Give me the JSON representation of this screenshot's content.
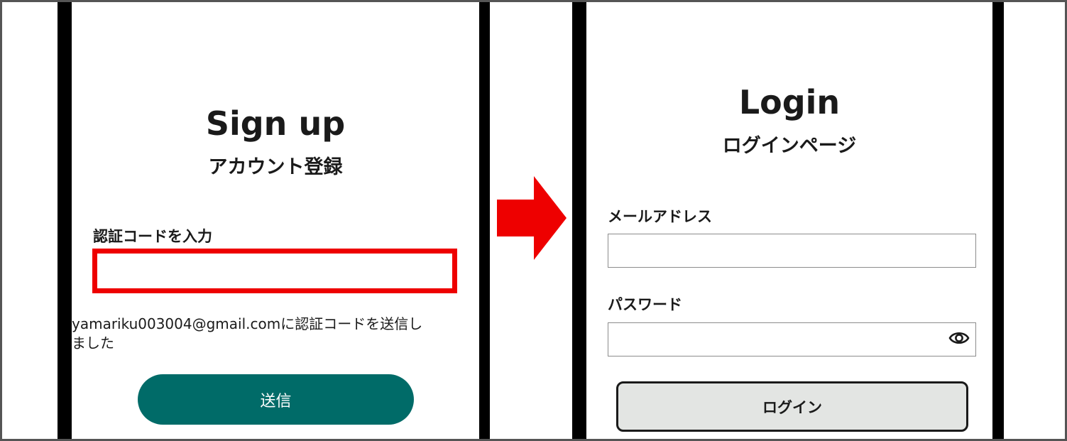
{
  "signup": {
    "title": "Sign up",
    "subtitle": "アカウント登録",
    "code_label": "認証コードを入力",
    "code_value": "",
    "note_line1": "yamariku003004@gmail.comに認証コードを送信し",
    "note_line2": "ました",
    "send_label": "送信"
  },
  "login": {
    "title": "Login",
    "subtitle": "ログインページ",
    "email_label": "メールアドレス",
    "email_value": "",
    "password_label": "パスワード",
    "password_value": "",
    "login_label": "ログイン"
  },
  "icons": {
    "eye": "eye-icon",
    "arrow": "arrow-right-icon"
  },
  "colors": {
    "highlight": "#ee0000",
    "send_button": "#006b68",
    "login_button": "#e3e5e3",
    "arrow": "#ee0000"
  }
}
